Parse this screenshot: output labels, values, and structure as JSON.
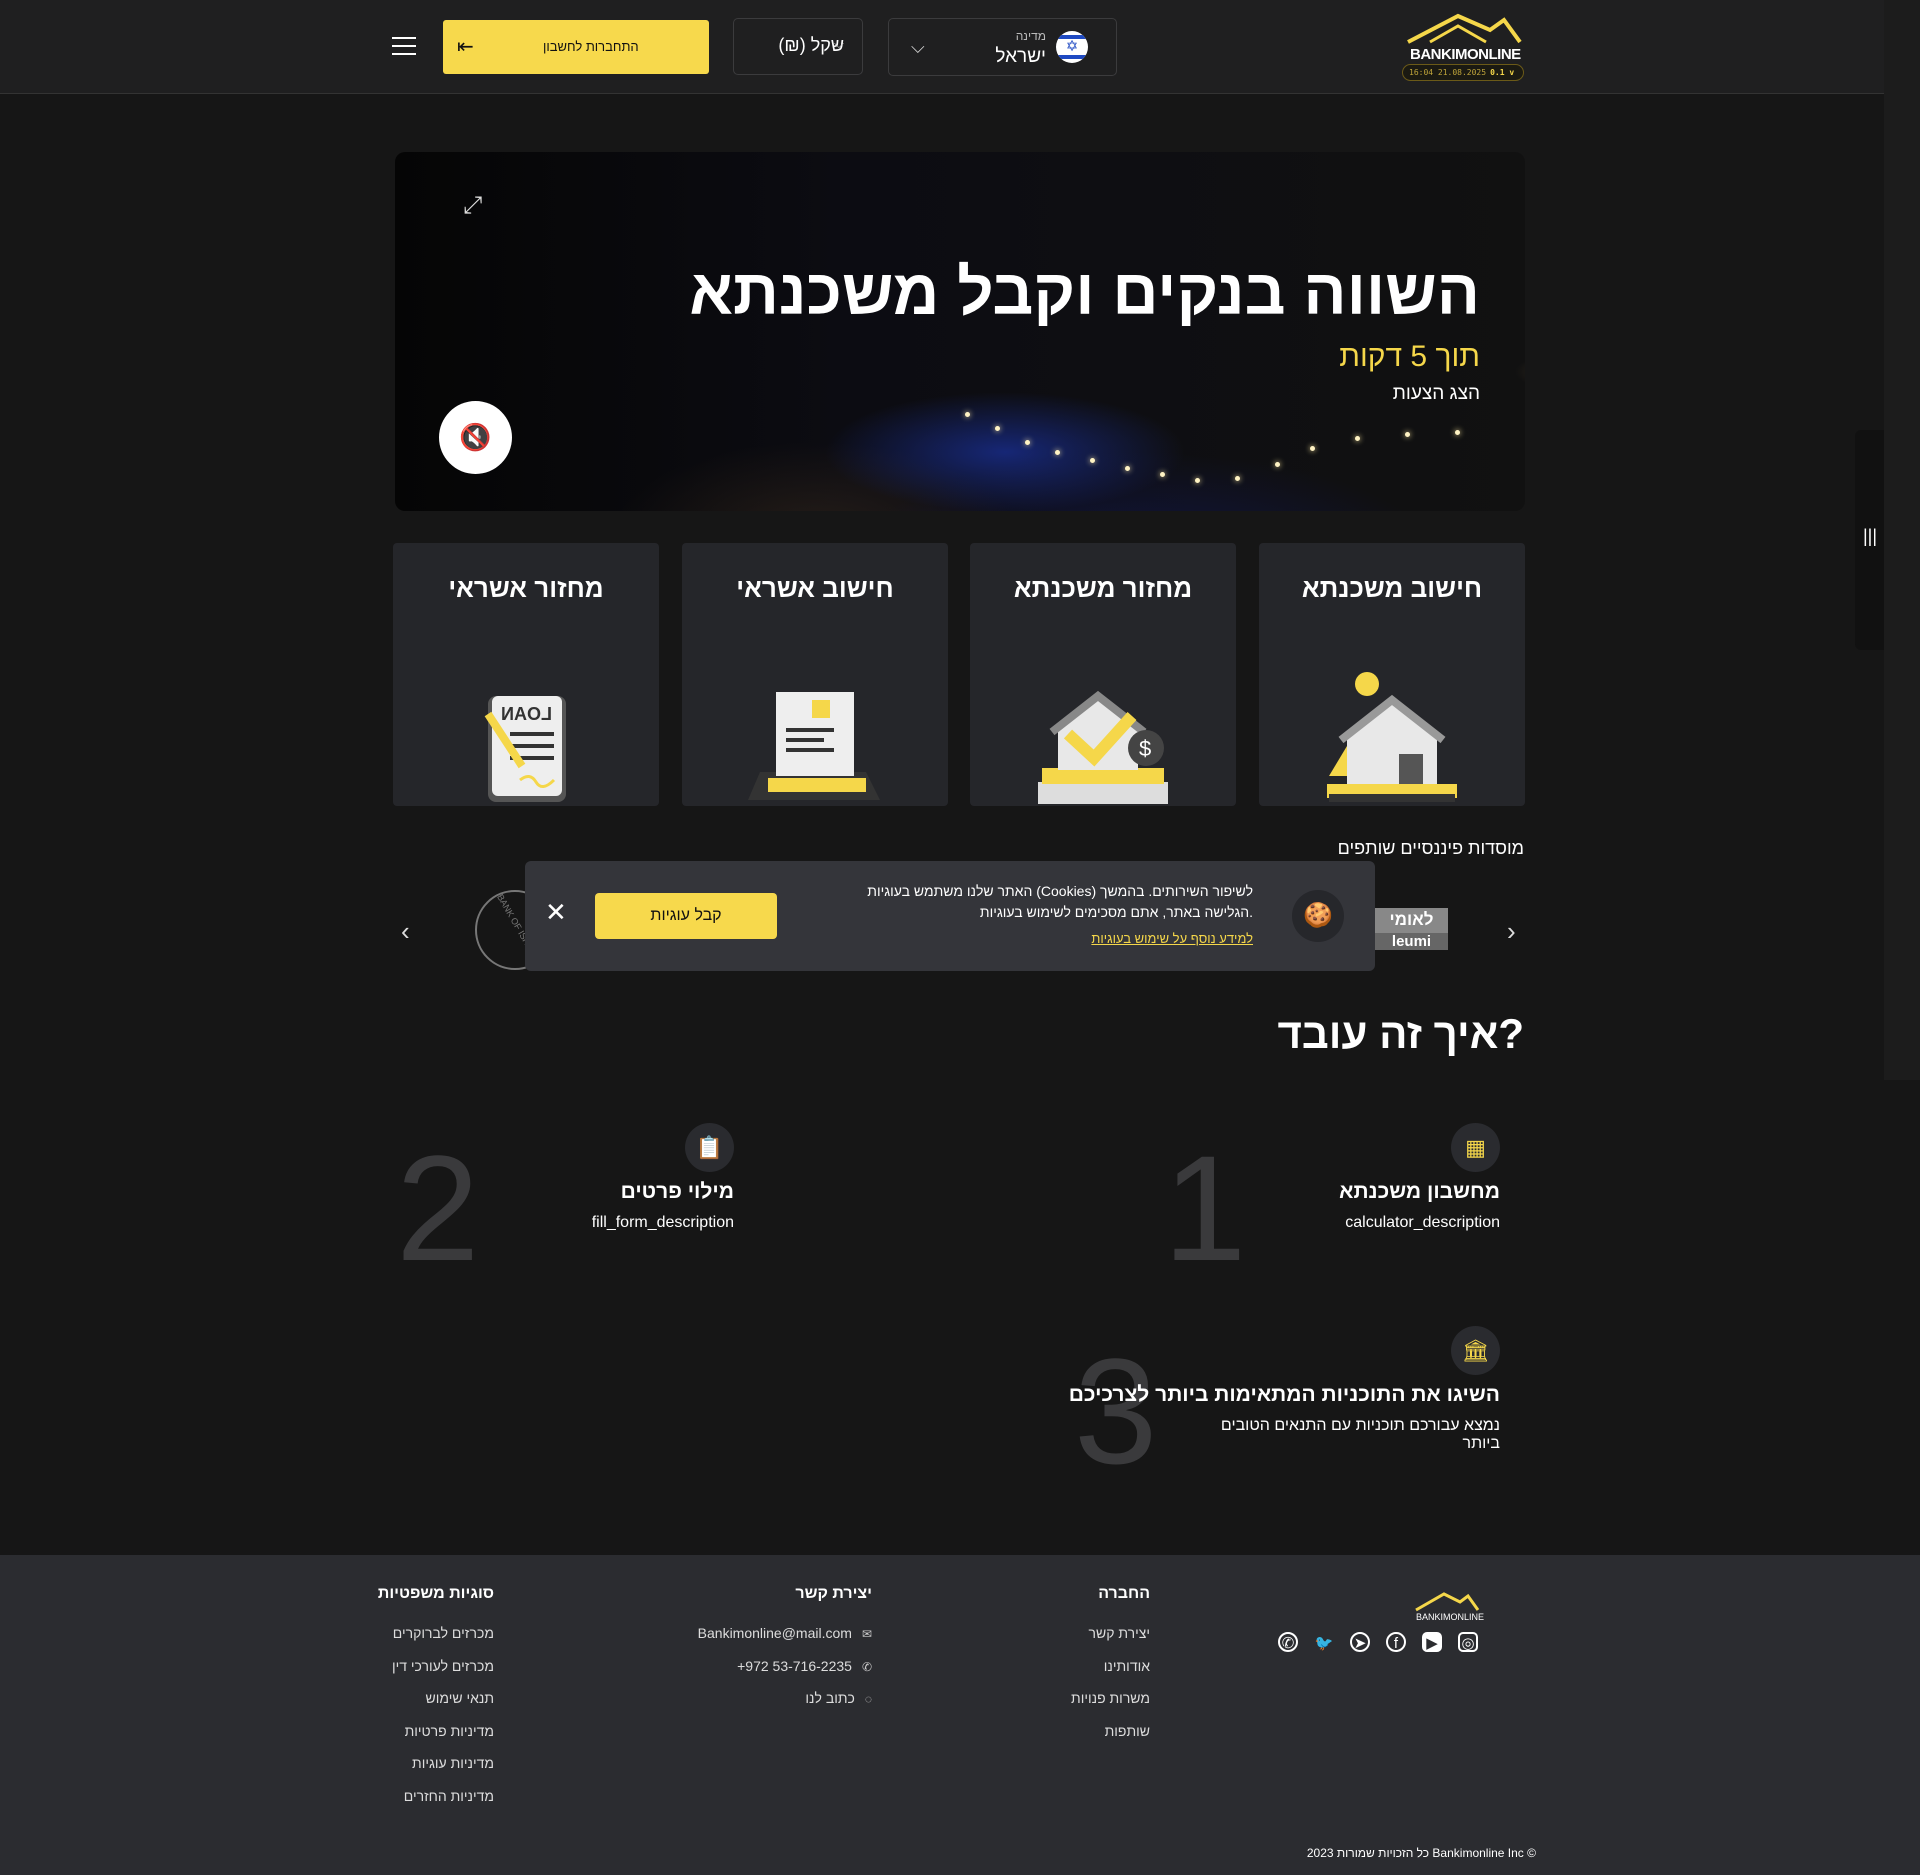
{
  "header": {
    "logo_brand_a": "BANKIM",
    "logo_brand_b": "ONLINE",
    "logo_badge": "16:04 21.08.2025",
    "logo_version": "0.1 v",
    "country_label": "מדינה",
    "country_value": "ישראל",
    "currency_value": "(₪) שקל",
    "login_label": "התחברות לחשבון"
  },
  "hero": {
    "title": "השווה בנקים וקבל משכנתא",
    "subtitle": "תוך 5 דקות",
    "subtitle2": "הצג הצעות"
  },
  "cards": [
    {
      "title": "חישוב משכנתא",
      "icon": "house-coin-icon"
    },
    {
      "title": "מחזור משכנתא",
      "icon": "house-refinance-icon"
    },
    {
      "title": "חישוב אשראי",
      "icon": "laptop-document-icon"
    },
    {
      "title": "מחזור אשראי",
      "icon": "loan-document-icon"
    }
  ],
  "partners": {
    "title": "מוסדות פיננסיים שותפים",
    "leumi_he": "לאומי",
    "leumi_en": "leumi",
    "boi": "BANK OF ISRAEL"
  },
  "cookie": {
    "text": "האתר שלנו משתמש בעוגיות (Cookies) לשיפור השירותים. בהמשך הגלישה באתר, אתם מסכימים לשימוש בעוגיות.",
    "link": "למידע נוסף על שימוש בעוגיות",
    "accept": "קבל עוגיות"
  },
  "how": {
    "title": "איך זה עובד?",
    "steps": [
      {
        "num": "1",
        "title": "מחשבון משכנתא",
        "desc": "calculator_description",
        "icon": "calculator-icon"
      },
      {
        "num": "2",
        "title": "מילוי פרטים",
        "desc": "fill_form_description",
        "icon": "clipboard-icon"
      },
      {
        "num": "3",
        "title": "השיגו את התוכניות המתאימות ביותר לצרכיכם",
        "desc": "נמצא עבורכם תוכניות עם התנאים הטובים ביותר",
        "icon": "bank-icon"
      }
    ]
  },
  "footer": {
    "logo": "BANKIMONLINE",
    "company": {
      "title": "החברה",
      "items": [
        "יצירת קשר",
        "אודותינו",
        "משרות פנויות",
        "שותפות"
      ]
    },
    "contact": {
      "title": "יצירת קשר",
      "email": "Bankimonline@mail.com",
      "phone": "+972 53-716-2235",
      "write": "כתוב לנו"
    },
    "legal": {
      "title": "סוגיות משפטיות",
      "items": [
        "מכרזים לברוקרים",
        "מכרזים לעורכי דין",
        "תנאי שימוש",
        "מדיניות פרטיות",
        "מדיניות עוגיות",
        "מדיניות החזרים"
      ]
    },
    "copyright": "2023 כל הזכויות שמורות Bankimonline Inc ©"
  },
  "colors": {
    "accent": "#f7d94c",
    "bg": "#161616",
    "card": "#25262a",
    "footer": "#2b2c30"
  }
}
